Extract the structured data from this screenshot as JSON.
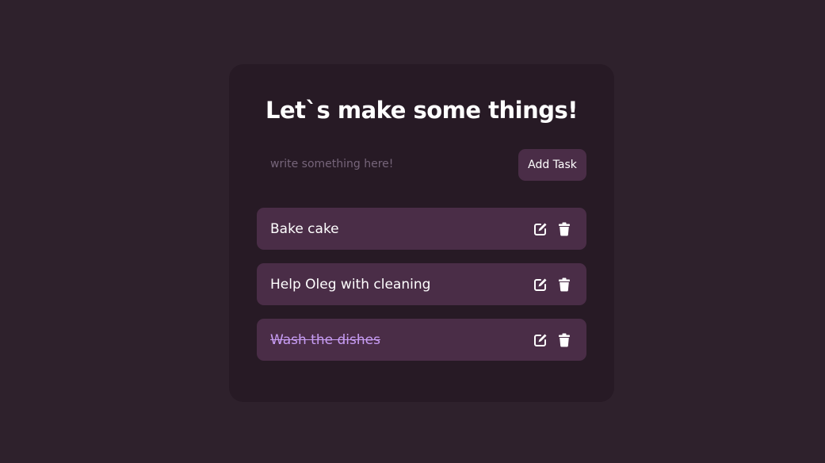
{
  "app": {
    "title": "Let`s make some things!"
  },
  "form": {
    "input_value": "",
    "input_placeholder": "write something here!",
    "add_label": "Add Task"
  },
  "todos": [
    {
      "text": "Bake cake",
      "completed": false
    },
    {
      "text": "Help Oleg with cleaning",
      "completed": false
    },
    {
      "text": "Wash the dishes",
      "completed": true
    }
  ],
  "icons": {
    "edit": "edit-icon",
    "delete": "trash-icon"
  },
  "colors": {
    "page_background": "#2e212c",
    "card_background": "#271a25",
    "item_background": "#4a2d47",
    "completed_text": "#c79cf3",
    "text": "#ffffff",
    "placeholder": "#76657a"
  }
}
